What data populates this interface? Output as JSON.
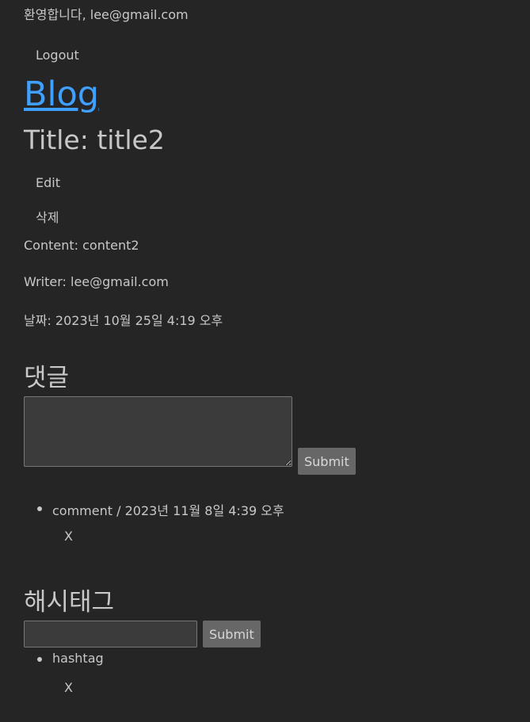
{
  "header": {
    "welcome": "환영합니다, lee@gmail.com",
    "logout_label": "Logout",
    "blog_link": "Blog"
  },
  "post": {
    "title": "Title: title2",
    "edit_label": "Edit",
    "delete_label": "삭제",
    "content": "Content: content2",
    "writer": "Writer: lee@gmail.com",
    "date": "날짜: 2023년 10월 25일 4:19 오후"
  },
  "comments": {
    "heading": "댓글",
    "textarea_value": "",
    "submit_label": "Submit",
    "items": [
      {
        "text": "comment / 2023년 11월 8일 4:39 오후",
        "delete_label": "X"
      }
    ]
  },
  "hashtags": {
    "heading": "해시태그",
    "input_value": "",
    "submit_label": "Submit",
    "items": [
      {
        "text": "hashtag",
        "delete_label": "X"
      }
    ]
  },
  "colors": {
    "background": "#252525",
    "link": "#3fa0ff",
    "button": "#676767"
  }
}
